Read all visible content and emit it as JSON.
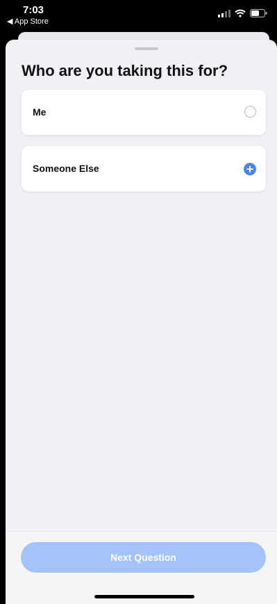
{
  "status_bar": {
    "time": "7:03",
    "back_app": "◀ App Store"
  },
  "sheet": {
    "title": "Who are you taking this for?",
    "options": [
      {
        "label": "Me",
        "control": "radio-empty"
      },
      {
        "label": "Someone Else",
        "control": "plus-icon"
      }
    ],
    "next_button_label": "Next Question"
  },
  "colors": {
    "accent": "#4a85f3",
    "button_disabled": "#a4c3fb",
    "sheet_bg": "#f1f1f5"
  }
}
